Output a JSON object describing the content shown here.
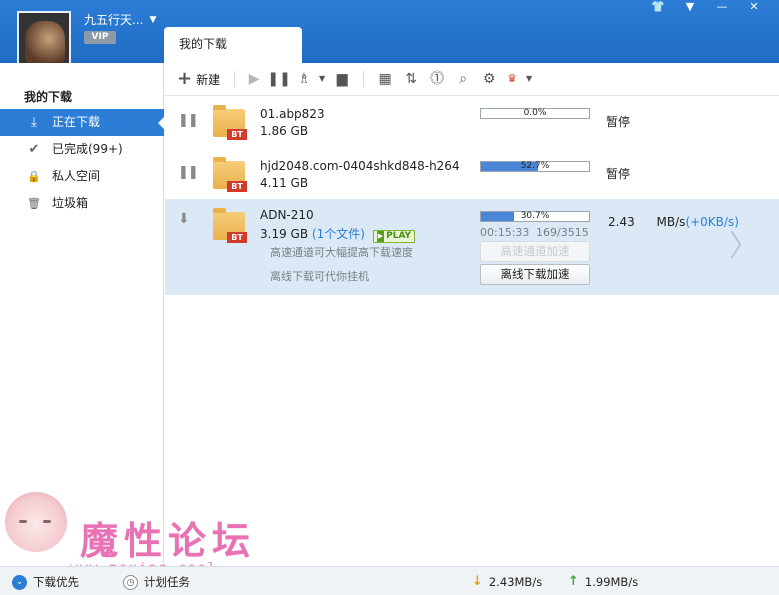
{
  "header": {
    "username": "九五行天...",
    "vip": "VIP",
    "tab": "我的下载"
  },
  "window_controls": [
    "👕",
    "▼",
    "—",
    "✕"
  ],
  "sidebar": {
    "title": "我的下载",
    "items": [
      {
        "label": "正在下载",
        "icon": "download-icon",
        "glyph": "⤓",
        "active": true
      },
      {
        "label": "已完成(99+)",
        "icon": "checkmark-icon",
        "glyph": "✔",
        "active": false
      },
      {
        "label": "私人空间",
        "icon": "lock-icon",
        "glyph": "🔒",
        "active": false
      },
      {
        "label": "垃圾箱",
        "icon": "trash-icon",
        "glyph": "🗑",
        "active": false
      }
    ]
  },
  "toolbar": {
    "new_label": "新建"
  },
  "downloads": [
    {
      "name": "01.abp823",
      "size": "1.86 GB",
      "progress_label": "0.0%",
      "progress": 0.0,
      "status": "暂停",
      "badge": "BT"
    },
    {
      "name": "hjd2048.com-0404shkd848-h264",
      "size": "4.11 GB",
      "progress_label": "52.7%",
      "progress": 0.527,
      "status": "暂停",
      "badge": "BT"
    },
    {
      "name": "ADN-210",
      "size": "3.19 GB",
      "files": "(1个文件)",
      "play": "PLAY",
      "progress_label": "30.7%",
      "progress": 0.307,
      "badge": "BT",
      "time": "00:15:33",
      "pieces": "169/3515",
      "speed": "2.43",
      "speed_unit": "MB/s",
      "speed_boost": "(+0KB/s)",
      "hint1": "高速通道可大幅提高下载速度",
      "hint2": "离线下载可代你挂机",
      "btn1": "高速通道加速",
      "btn2": "离线下载加速"
    }
  ],
  "statusbar": {
    "priority": "下载优先",
    "schedule": "计划任务",
    "down_speed": "2.43MB/s",
    "up_speed": "1.99MB/s"
  },
  "watermark": {
    "title": "魔性论坛",
    "url": "www.moxing.cool"
  }
}
